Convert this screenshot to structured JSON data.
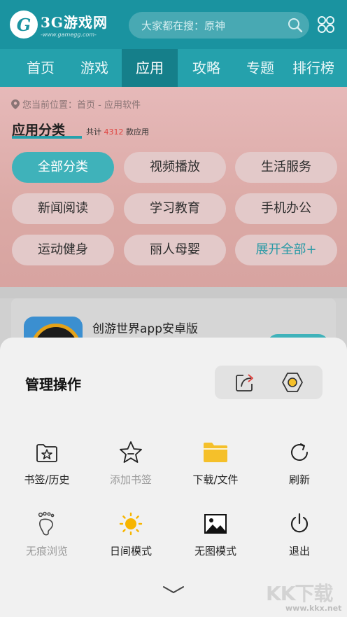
{
  "header": {
    "logo_mark": "G",
    "logo_name": "3G游戏网",
    "logo_url": "-www.gamegg.com-",
    "search_placeholder": "大家都在搜：原神",
    "icons": [
      "search-icon",
      "grid-menu-icon"
    ]
  },
  "nav": {
    "items": [
      "首页",
      "游戏",
      "应用",
      "攻略",
      "专题",
      "排行榜"
    ],
    "active_index": 2
  },
  "page": {
    "breadcrumb": "您当前位置：首页 - 应用软件",
    "section_title": "应用分类",
    "total_prefix": "共计",
    "total_count": "4312",
    "total_suffix": "款应用",
    "categories": [
      "全部分类",
      "视频播放",
      "生活服务",
      "新闻阅读",
      "学习教育",
      "手机办公",
      "运动健身",
      "丽人母婴",
      "展开全部+"
    ],
    "first_app_name": "创游世界app安卓版"
  },
  "sheet": {
    "title": "管理操作",
    "quick_actions": [
      {
        "name": "share-icon"
      },
      {
        "name": "settings-icon"
      }
    ],
    "items": [
      {
        "label": "书签/历史",
        "icon": "bookmark-folder-icon",
        "dim": false
      },
      {
        "label": "添加书签",
        "icon": "star-icon",
        "dim": true
      },
      {
        "label": "下载/文件",
        "icon": "folder-icon",
        "dim": false
      },
      {
        "label": "刷新",
        "icon": "refresh-icon",
        "dim": false
      },
      {
        "label": "无痕浏览",
        "icon": "footprint-icon",
        "dim": true
      },
      {
        "label": "日间模式",
        "icon": "sun-icon",
        "dim": false
      },
      {
        "label": "无图模式",
        "icon": "image-icon",
        "dim": false
      },
      {
        "label": "退出",
        "icon": "power-icon",
        "dim": false
      }
    ],
    "collapse_icon": "chevron-down-icon"
  },
  "watermark": {
    "big": "KK下载",
    "url": "www.kkx.net"
  },
  "colors": {
    "brand": "#1a93a0",
    "nav_active": "#157f8a",
    "chip_active": "#3fb2ba",
    "count_red": "#e0433f",
    "folder_yellow": "#f5c02a",
    "sun_yellow": "#f7b500"
  }
}
